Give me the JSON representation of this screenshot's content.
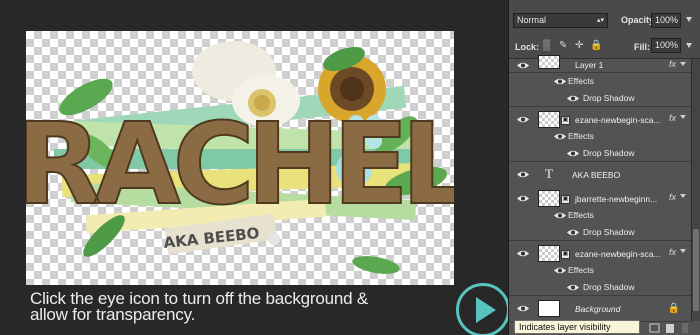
{
  "caption": {
    "line1": "Click the eye icon to turn off the background &",
    "line2": "allow for transparency."
  },
  "artwork": {
    "title": "RACHEL",
    "subtitle": "AKA BEEBO"
  },
  "panel": {
    "blend_mode": "Normal",
    "opacity_label": "Opacity:",
    "opacity_value": "100%",
    "lock_label": "Lock:",
    "fill_label": "Fill:",
    "fill_value": "100%",
    "layers": [
      {
        "name": "Layer 1",
        "fx": "fx",
        "effects": "Effects",
        "effect": "Drop Shadow"
      },
      {
        "name": "ezane-newbegin-sca...",
        "fx": "fx",
        "effects": "Effects",
        "effect": "Drop Shadow"
      },
      {
        "name": "AKA BEEBO",
        "type_icon": "T"
      },
      {
        "name": "jbarrette-newbeginn...",
        "fx": "fx",
        "effects": "Effects",
        "effect": "Drop Shadow"
      },
      {
        "name": "ezane-newbegin-sca...",
        "fx": "fx",
        "effects": "Effects",
        "effect": "Drop Shadow"
      },
      {
        "name": "Background"
      }
    ]
  },
  "tooltip": "Indicates layer visibility",
  "icons": {
    "eye": "eye-icon",
    "play": "play-icon",
    "lock": "lock-icon",
    "chevron": "chevron-down-icon"
  },
  "colors": {
    "accent": "#58c4c0",
    "panel_bg": "#535353",
    "tooltip_bg": "#f8f4d8"
  }
}
